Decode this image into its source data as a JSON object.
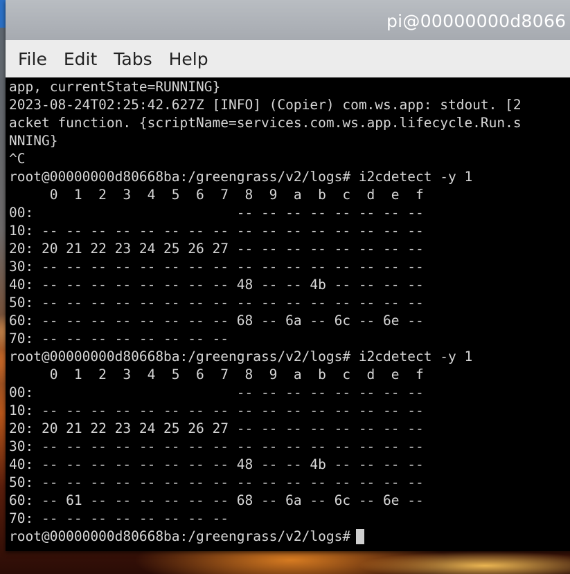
{
  "window": {
    "title": "pi@00000000d8066"
  },
  "menu": {
    "items": [
      "File",
      "Edit",
      "Tabs",
      "Help"
    ]
  },
  "terminal": {
    "lines": [
      "app, currentState=RUNNING}",
      "2023-08-24T02:25:42.627Z [INFO] (Copier) com.ws.app: stdout. [2",
      "acket function. {scriptName=services.com.ws.app.lifecycle.Run.s",
      "NNING}",
      "^C",
      "root@00000000d80668ba:/greengrass/v2/logs# i2cdetect -y 1",
      "     0  1  2  3  4  5  6  7  8  9  a  b  c  d  e  f",
      "00:                         -- -- -- -- -- -- -- --",
      "10: -- -- -- -- -- -- -- -- -- -- -- -- -- -- -- --",
      "20: 20 21 22 23 24 25 26 27 -- -- -- -- -- -- -- --",
      "30: -- -- -- -- -- -- -- -- -- -- -- -- -- -- -- --",
      "40: -- -- -- -- -- -- -- -- 48 -- -- 4b -- -- -- --",
      "50: -- -- -- -- -- -- -- -- -- -- -- -- -- -- -- --",
      "60: -- -- -- -- -- -- -- -- 68 -- 6a -- 6c -- 6e --",
      "70: -- -- -- -- -- -- -- --",
      "root@00000000d80668ba:/greengrass/v2/logs# i2cdetect -y 1",
      "     0  1  2  3  4  5  6  7  8  9  a  b  c  d  e  f",
      "00:                         -- -- -- -- -- -- -- --",
      "10: -- -- -- -- -- -- -- -- -- -- -- -- -- -- -- --",
      "20: 20 21 22 23 24 25 26 27 -- -- -- -- -- -- -- --",
      "30: -- -- -- -- -- -- -- -- -- -- -- -- -- -- -- --",
      "40: -- -- -- -- -- -- -- -- 48 -- -- 4b -- -- -- --",
      "50: -- -- -- -- -- -- -- -- -- -- -- -- -- -- -- --",
      "60: -- 61 -- -- -- -- -- -- 68 -- 6a -- 6c -- 6e --",
      "70: -- -- -- -- -- -- -- --"
    ],
    "prompt": "root@00000000d80668ba:/greengrass/v2/logs#"
  },
  "colors": {
    "terminal_bg": "#000000",
    "terminal_fg": "#d6d6d6",
    "titlebar_bg": "#aeb2b7",
    "menubar_bg": "#ececec"
  }
}
